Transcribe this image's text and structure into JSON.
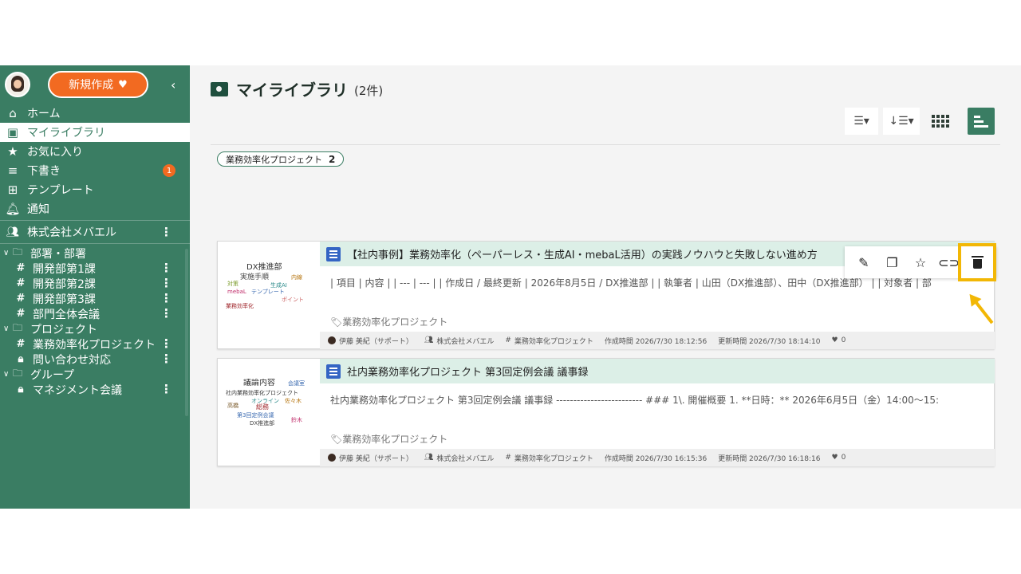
{
  "sidebar": {
    "new_button": "新規作成",
    "new_button_icon": "heart-icon",
    "badge_draft": "1",
    "nav": [
      {
        "label": "ホーム",
        "icon": "home-icon"
      },
      {
        "label": "マイライブラリ",
        "icon": "library-icon"
      },
      {
        "label": "お気に入り",
        "icon": "star-icon"
      },
      {
        "label": "下書き",
        "icon": "draft-icon"
      },
      {
        "label": "テンプレート",
        "icon": "template-icon"
      },
      {
        "label": "通知",
        "icon": "bell-icon"
      }
    ],
    "org": "株式会社メバエル",
    "groups": [
      {
        "label": "部署・部署",
        "items": [
          "開発部第1課",
          "開発部第2課",
          "開発部第3課",
          "部門全体会議"
        ]
      },
      {
        "label": "プロジェクト",
        "items": [
          "業務効率化プロジェクト",
          "問い合わせ対応"
        ]
      },
      {
        "label": "グループ",
        "items": [
          "マネジメント会議"
        ]
      }
    ]
  },
  "main": {
    "title": "マイライブラリ",
    "count": "(2件)",
    "tag_chip": {
      "label": "業務効率化プロジェクト",
      "count": "2"
    },
    "cards": [
      {
        "title": "【社内事例】業務効率化（ペーパーレス・生成AI・mebaL活用）の実践ノウハウと失敗しない進め方",
        "body": "| 項目 | 内容 | | --- | --- | | 作成日 / 最終更新 | 2026年8月5日 / DX推進部 | | 執筆者 | 山田（DX推進部）、田中（DX推進部） | | 対象者 | 部",
        "tag": "業務効率化プロジェクト",
        "author": "伊藤 美紀（サポート）",
        "org": "株式会社メバエル",
        "project": "業務効率化プロジェクト",
        "created": "作成時間 2026/7/30 18:12:56",
        "updated": "更新時間 2026/7/30 18:14:10",
        "likes": "0",
        "wordcloud": [
          "DX推進部",
          "内線",
          "実施手順",
          "mebaL",
          "テンプレート",
          "ポイント",
          "業務効率化",
          "対策",
          "生成AI"
        ]
      },
      {
        "title": "社内業務効率化プロジェクト 第3回定例会議 議事録",
        "body": "社内業務効率化プロジェクト 第3回定例会議 議事録 ------------------------- ### 1\\. 開催概要 1. **日時：** 2026年6月5日（金）14:00〜15:",
        "tag": "業務効率化プロジェクト",
        "author": "伊藤 美紀（サポート）",
        "org": "株式会社メバエル",
        "project": "業務効率化プロジェクト",
        "created": "作成時間 2026/7/30 16:15:36",
        "updated": "更新時間 2026/7/30 16:18:16",
        "likes": "0",
        "wordcloud": [
          "議論内容",
          "会議室",
          "社内業務効率化プロジェクト",
          "オンライン",
          "総務",
          "高橋",
          "佐々木",
          "DX推進部",
          "鈴木",
          "第3回定例会議"
        ]
      }
    ]
  },
  "colors": {
    "sidebar": "#3a7d63",
    "accent": "#f26a21",
    "highlight": "#f2b705",
    "card_header": "#dcefe7"
  }
}
